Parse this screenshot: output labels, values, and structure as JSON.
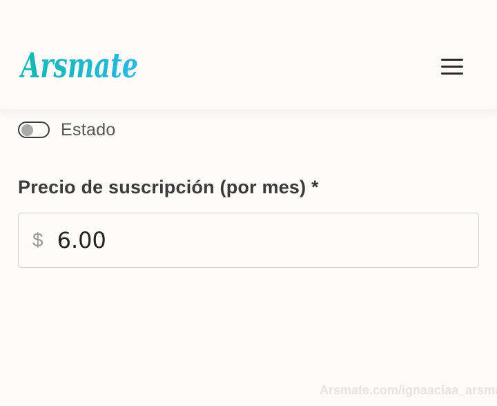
{
  "header": {
    "logo_text": "Arsmate",
    "logo_color_start": "#16b8b0",
    "logo_color_end": "#2ab7e2",
    "menu_icon": "hamburger-menu-icon"
  },
  "status_toggle": {
    "label": "Estado",
    "enabled": false
  },
  "price": {
    "label": "Precio de suscripción (por mes) *",
    "currency_symbol": "$",
    "value": "6.00"
  },
  "watermark": "Arsmate.com/ignaaciaa_arsmate"
}
